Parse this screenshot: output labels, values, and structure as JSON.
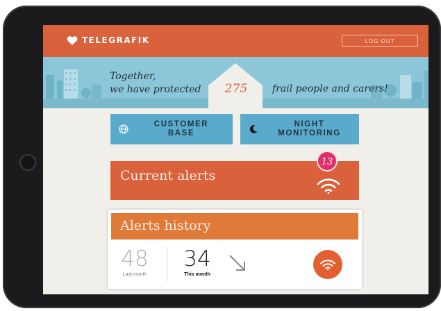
{
  "app": {
    "logo_text": "TELEGRAFIK",
    "logout_label": "LOG OUT"
  },
  "banner": {
    "line1": "Together,",
    "line2": "we have protected",
    "count": "275",
    "line3": "frail people and carers!"
  },
  "tiles": {
    "customer": {
      "line1": "CUSTOMER",
      "line2": "BASE",
      "icon": "globe-icon"
    },
    "night": {
      "line1": "NIGHT",
      "line2": "MONITORING",
      "icon": "moon-icon"
    }
  },
  "current_alerts": {
    "title": "Current alerts",
    "badge": "13",
    "icon": "signal-icon"
  },
  "alerts_history": {
    "title": "Alerts history",
    "last_value": "48",
    "last_label": "Last month",
    "this_value": "34",
    "this_label": "This month",
    "trend_icon": "arrow-down-right-icon",
    "button_icon": "signal-icon"
  },
  "colors": {
    "orange": "#d9613b",
    "amber": "#e07a38",
    "blue": "#5aaacb",
    "sky": "#8cc7d9",
    "badge": "#e0306a"
  }
}
